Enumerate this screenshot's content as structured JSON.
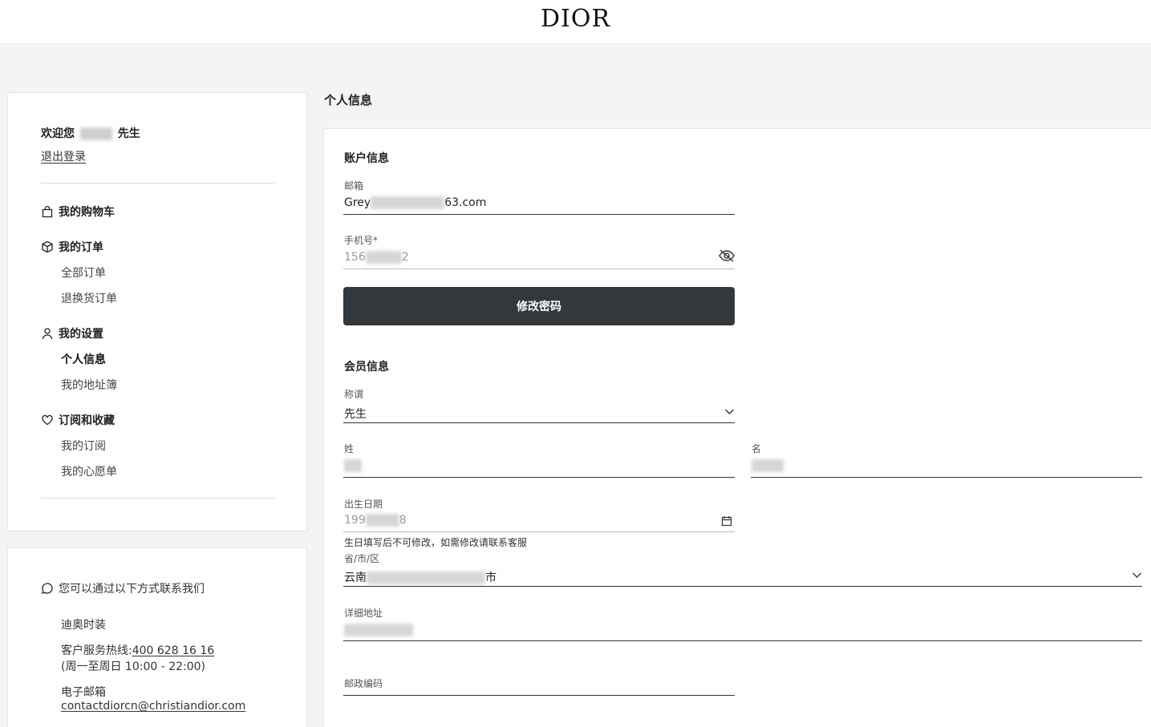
{
  "header": {
    "logo": "DIOR"
  },
  "sidebar": {
    "welcome_prefix": "欢迎您",
    "welcome_suffix": "先生",
    "logout": "退出登录",
    "groups": [
      {
        "label": "我的购物车",
        "icon": "shopping-bag-icon"
      },
      {
        "label": "我的订单",
        "icon": "package-icon",
        "items": [
          "全部订单",
          "退换货订单"
        ]
      },
      {
        "label": "我的设置",
        "icon": "user-icon",
        "items": [
          "个人信息",
          "我的地址簿"
        ]
      },
      {
        "label": "订阅和收藏",
        "icon": "heart-icon",
        "items": [
          "我的订阅",
          "我的心愿单"
        ]
      }
    ]
  },
  "contact": {
    "title": "您可以通过以下方式联系我们",
    "brand": "迪奥时装",
    "hotline_label": "客户服务热线:",
    "hotline": "400 628 16 16",
    "hours": "(周一至周日 10:00 - 22:00)",
    "email_label": "电子邮箱",
    "email": "contactdiorcn@christiandior.com"
  },
  "main": {
    "page_title": "个人信息",
    "account_section": "账户信息",
    "email_label": "邮箱",
    "email_prefix": "Grey",
    "email_suffix": "63.com",
    "phone_label": "手机号*",
    "phone_prefix": "156",
    "phone_suffix": "2",
    "change_password": "修改密码",
    "member_section": "会员信息",
    "title_label": "称谓",
    "title_value": "先生",
    "surname_label": "姓",
    "given_label": "名",
    "birth_label": "出生日期",
    "birth_prefix": "199",
    "birth_suffix": "8",
    "birth_hint": "生日填写后不可修改，如需修改请联系客服",
    "region_label": "省/市/区",
    "region_prefix": "云南",
    "region_suffix": "市",
    "address_label": "详细地址",
    "postcode_label": "邮政编码"
  }
}
